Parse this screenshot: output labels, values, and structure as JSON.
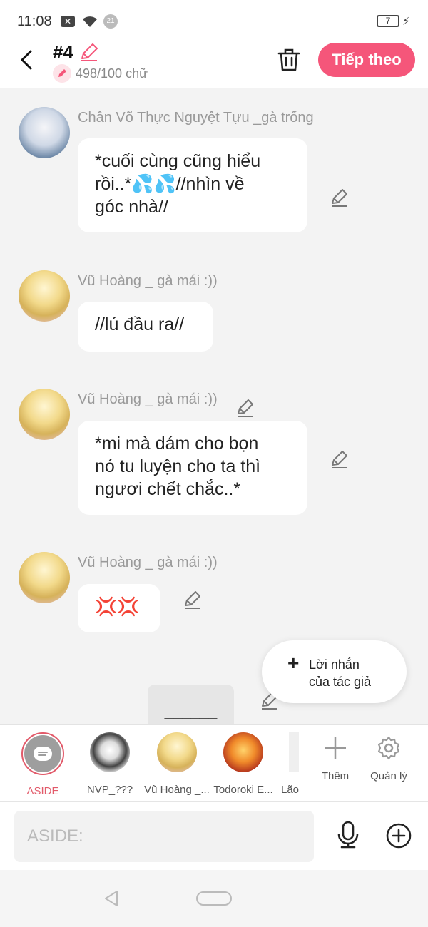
{
  "status_bar": {
    "time": "11:08",
    "notification_badge": "21",
    "battery_level": "7"
  },
  "header": {
    "episode": "#4",
    "word_count": "498/100 chữ",
    "next_label": "Tiếp theo"
  },
  "messages": [
    {
      "sender": "Chân Võ Thực Nguyệt Tựu _gà trống",
      "text_lines": [
        "*cuối cùng cũng hiểu",
        "rồi..*💦💦//nhìn về",
        "góc nhà//"
      ],
      "avatar": "white-hair-character"
    },
    {
      "sender": "Vũ Hoàng _ gà mái :))",
      "text_lines": [
        "//lú đầu ra//"
      ],
      "avatar": "golden-character"
    },
    {
      "sender": "Vũ Hoàng _ gà mái :))",
      "text_lines": [
        "*mi mà dám cho bọn",
        "nó tu luyện cho ta thì",
        "ngươi chết chắc..*"
      ],
      "avatar": "golden-character"
    },
    {
      "sender": "Vũ Hoàng _ gà mái :))",
      "text_lines": [
        "💢💢"
      ],
      "avatar": "golden-character"
    }
  ],
  "partial_message": "______",
  "author_note": {
    "line1": "Lời nhắn",
    "line2": "của tác giả"
  },
  "characters": [
    {
      "name": "ASIDE",
      "selected": true
    },
    {
      "name": "NVP_???"
    },
    {
      "name": "Vũ Hoàng _..."
    },
    {
      "name": "Todoroki E..."
    },
    {
      "name": "Lão"
    }
  ],
  "tools": {
    "add_label": "Thêm",
    "manage_label": "Quản lý"
  },
  "composer": {
    "placeholder": "ASIDE:"
  },
  "colors": {
    "accent": "#f5567a",
    "selected_ring": "#e25a6a"
  }
}
